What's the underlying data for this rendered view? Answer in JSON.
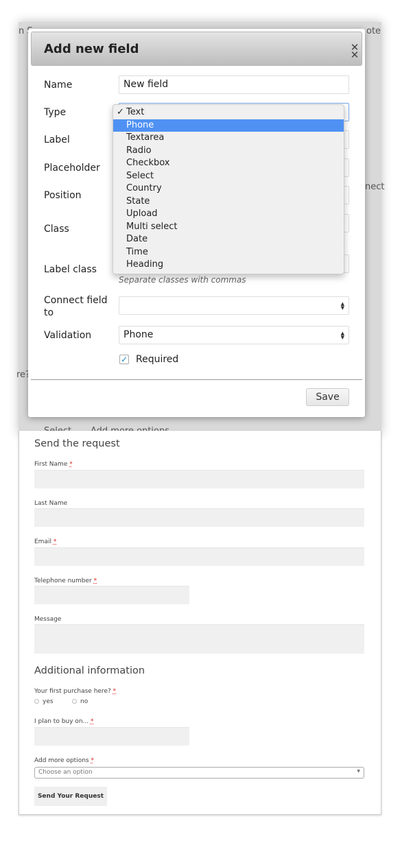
{
  "background": {
    "fragments": [
      "n S",
      "ote",
      "nect",
      "re?",
      "Select",
      "Add more options"
    ]
  },
  "modal": {
    "title": "Add new field",
    "close_icon": "close-icon",
    "fields": {
      "name_label": "Name",
      "name_value": "New field",
      "type_label": "Type",
      "label_label": "Label",
      "placeholder_label": "Placeholder",
      "position_label": "Position",
      "class_label": "Class",
      "label_class_label": "Label class",
      "label_class_hint": "Separate classes with commas",
      "connect_label": "Connect field to",
      "connect_value": "",
      "validation_label": "Validation",
      "validation_value": "Phone",
      "required_label": "Required",
      "required_checked": true
    },
    "type_dropdown": {
      "checked": "Text",
      "highlighted": "Phone",
      "highlight_color": "#4f91f3",
      "options": [
        "Text",
        "Phone",
        "Textarea",
        "Radio",
        "Checkbox",
        "Select",
        "Country",
        "State",
        "Upload",
        "Multi select",
        "Date",
        "Time",
        "Heading"
      ]
    },
    "save_label": "Save"
  },
  "form": {
    "section1_title": "Send the request",
    "first_name": "First Name",
    "last_name": "Last Name",
    "email": "Email",
    "telephone": "Telephone number",
    "message": "Message",
    "required_mark": "*",
    "section2_title": "Additional information",
    "first_purchase": "Your first purchase here?",
    "yes": "yes",
    "no": "no",
    "plan_to_buy": "I plan to buy on...",
    "more_options": "Add more options",
    "choose_placeholder": "Choose an option",
    "submit_label": "Send Your Request"
  }
}
